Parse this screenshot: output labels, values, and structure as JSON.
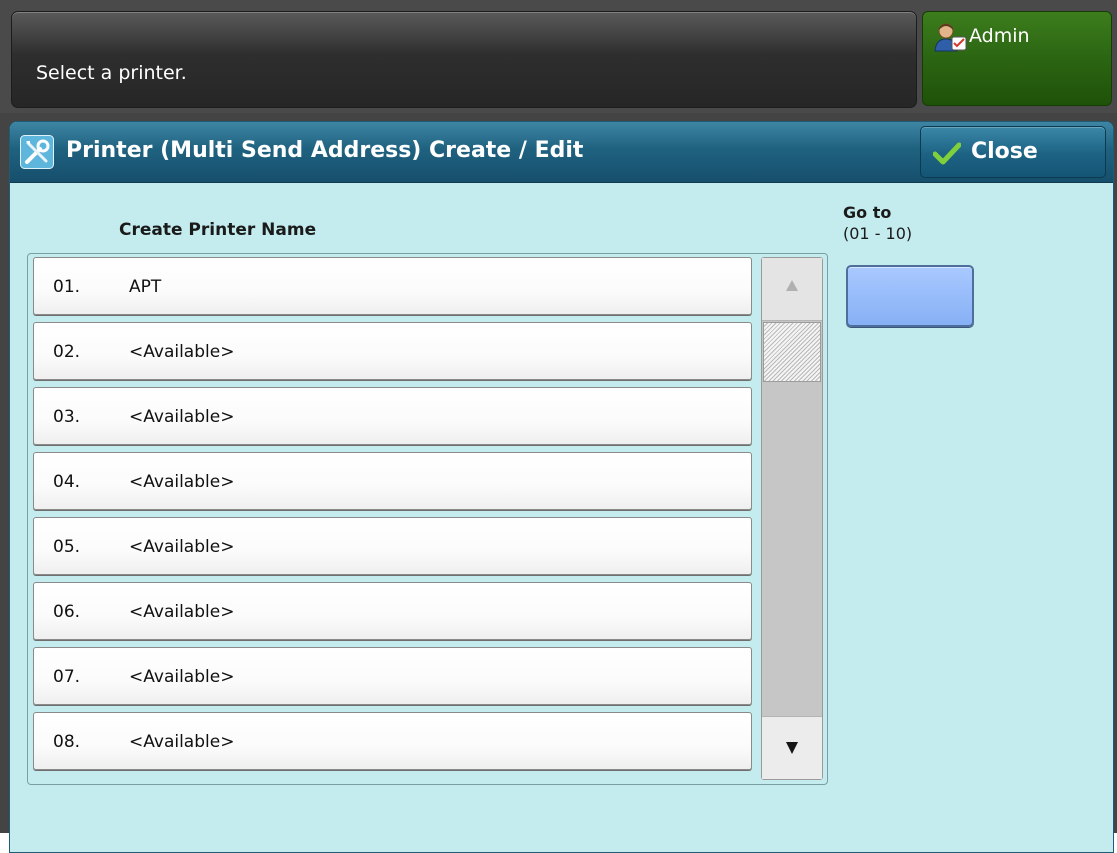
{
  "message": "Select a printer.",
  "admin_button": {
    "label": "Admin",
    "icon": "admin-user-icon"
  },
  "title_bar": {
    "title": "Printer (Multi Send Address) Create / Edit",
    "icon": "tools-icon"
  },
  "close_button": {
    "label": "Close",
    "icon": "checkmark-icon"
  },
  "list": {
    "header": "Create Printer Name",
    "rows": [
      {
        "number": "01.",
        "name": "APT"
      },
      {
        "number": "02.",
        "name": "<Available>"
      },
      {
        "number": "03.",
        "name": "<Available>"
      },
      {
        "number": "04.",
        "name": "<Available>"
      },
      {
        "number": "05.",
        "name": "<Available>"
      },
      {
        "number": "06.",
        "name": "<Available>"
      },
      {
        "number": "07.",
        "name": "<Available>"
      },
      {
        "number": "08.",
        "name": "<Available>"
      }
    ]
  },
  "goto": {
    "label": "Go to",
    "range": "(01 - 10)",
    "value": ""
  },
  "colors": {
    "panel_background": "#c4ecee",
    "title_bar": "#1f6280",
    "admin_button": "#2b6512",
    "goto_field": "#98bbf8"
  }
}
